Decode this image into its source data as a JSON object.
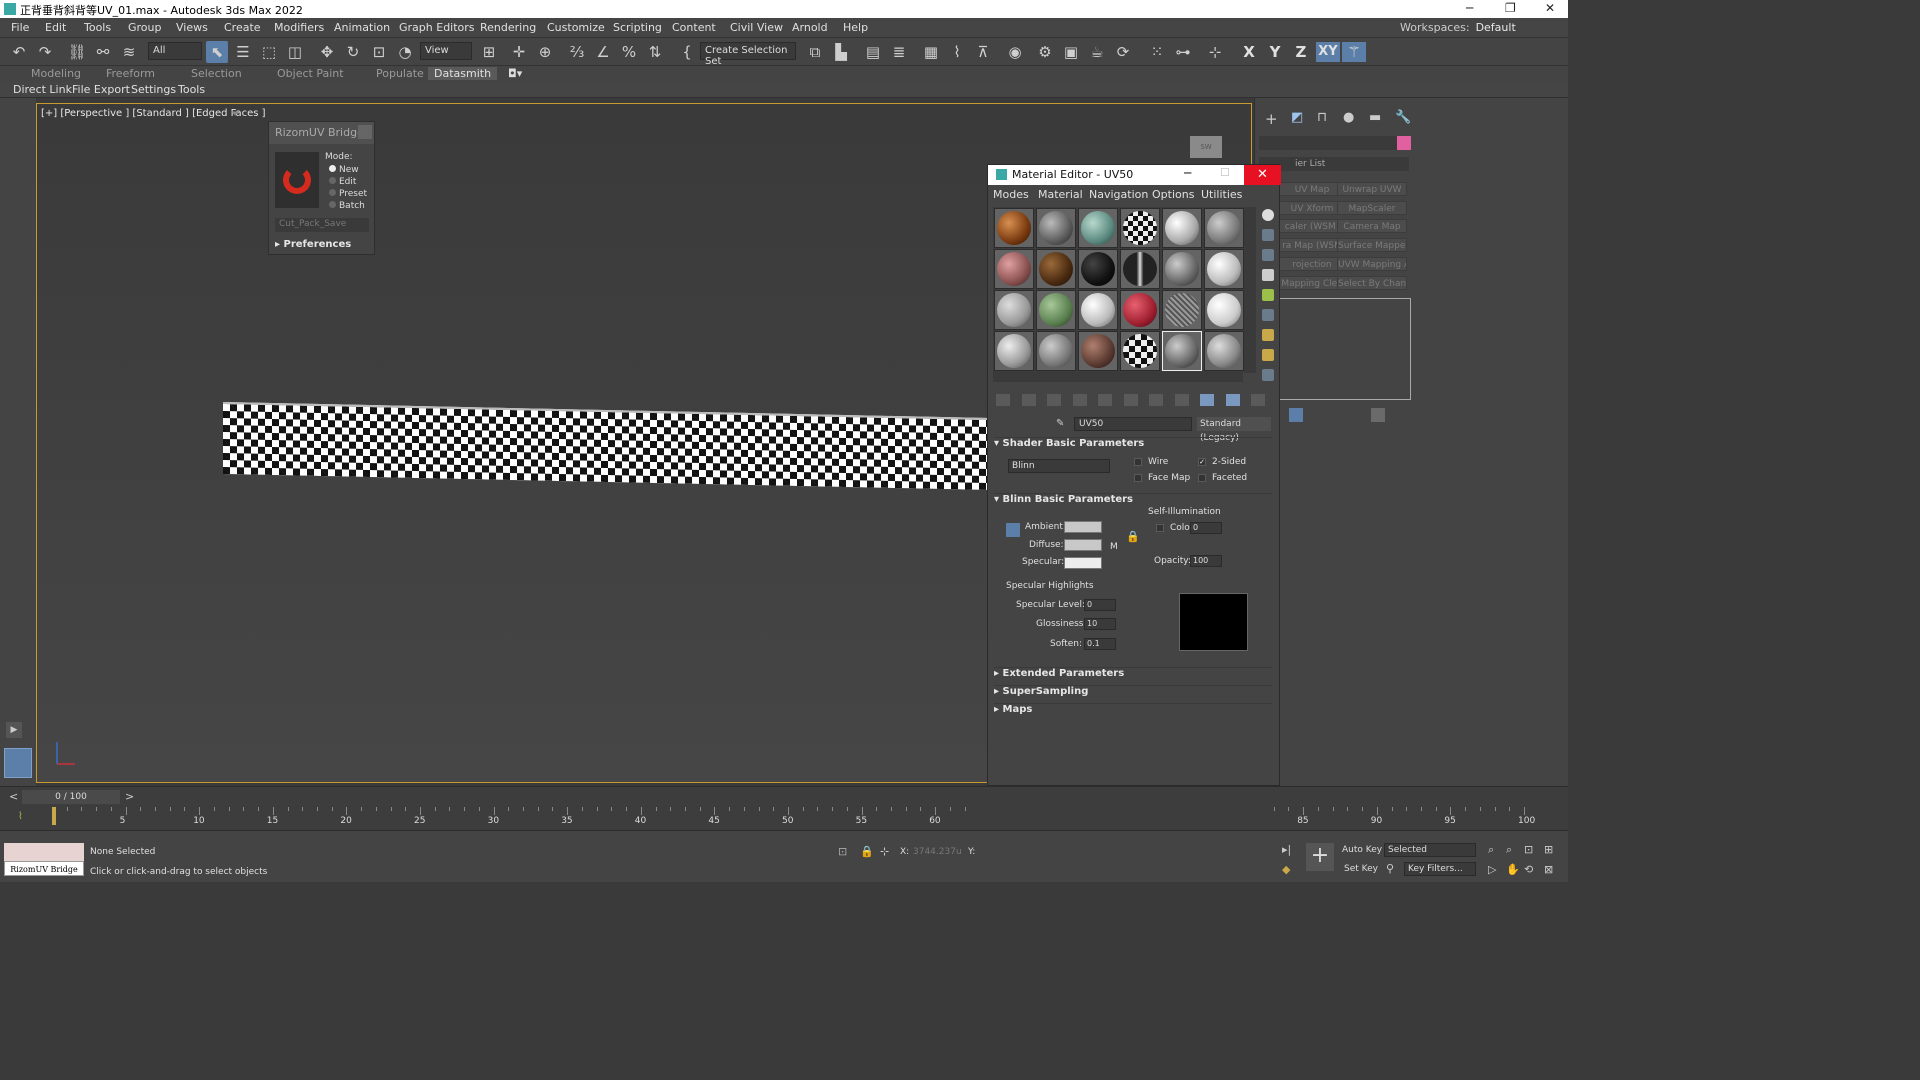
{
  "window": {
    "title": "正背垂背斜背等UV_01.max - Autodesk 3ds Max 2022",
    "minimize": "─",
    "restore": "❐",
    "close": "✕"
  },
  "menu": [
    "File",
    "Edit",
    "Tools",
    "Group",
    "Views",
    "Create",
    "Modifiers",
    "Animation",
    "Graph Editors",
    "Rendering",
    "Customize",
    "Scripting",
    "Content",
    "Civil View",
    "Arnold",
    "Help"
  ],
  "workspace": {
    "label": "Workspaces:",
    "value": "Default"
  },
  "toolbar": {
    "filter": "All",
    "refcoord": "View",
    "selection_set": "Create Selection Set",
    "axes": [
      "X",
      "Y",
      "Z",
      "XY"
    ]
  },
  "ribbon_tabs": [
    "Modeling",
    "Freeform",
    "Selection",
    "Object Paint",
    "Populate",
    "Datasmith"
  ],
  "secondary_menu": [
    "Direct Link",
    "File Export",
    "Settings",
    "Tools"
  ],
  "viewport": {
    "label": "[+] [Perspective ] [Standard ] [Edged Faces ]"
  },
  "rizom_bridge": {
    "title": "RizomUV Bridge",
    "mode_label": "Mode:",
    "modes": [
      "New",
      "Edit",
      "Preset",
      "Batch"
    ],
    "selected_mode": "New",
    "preset_dropdown": "Cut_Pack_Save",
    "preferences": "Preferences"
  },
  "material_editor": {
    "title": "Material Editor - UV50",
    "menu": [
      "Modes",
      "Material",
      "Navigation",
      "Options",
      "Utilities"
    ],
    "material_name": "UV50",
    "material_type": "Standard (Legacy)",
    "rollouts": {
      "shader_basic": "Shader Basic Parameters",
      "blinn_basic": "Blinn Basic Parameters",
      "extended": "Extended Parameters",
      "supersampling": "SuperSampling",
      "maps": "Maps"
    },
    "shader": "Blinn",
    "options": {
      "wire": "Wire",
      "two_sided": "2-Sided",
      "face_map": "Face Map",
      "faceted": "Faceted"
    },
    "colors": {
      "ambient_label": "Ambient:",
      "diffuse_label": "Diffuse:",
      "specular_label": "Specular:",
      "ambient": "#c8c8c8",
      "diffuse": "#c8c8c8",
      "specular": "#ececec",
      "map_button": "M"
    },
    "self_illum": {
      "title": "Self-Illumination",
      "color_label": "Color",
      "value": "0"
    },
    "opacity": {
      "label": "Opacity:",
      "value": "100"
    },
    "specular_highlights": {
      "title": "Specular Highlights",
      "level_label": "Specular Level:",
      "level": "0",
      "gloss_label": "Glossiness:",
      "gloss": "10",
      "soften_label": "Soften:",
      "soften": "0.1"
    }
  },
  "command_panel": {
    "modifier_list": "ier List",
    "buttons": [
      "UV Map",
      "Unwrap UVW",
      "UV Xform",
      "MapScaler",
      "caler (WSM)",
      "Camera Map",
      "ra Map (WSM",
      "Surface Mapper (",
      "rojection",
      "UVW Mapping Add",
      "Mapping Clea",
      "Select By Channel"
    ]
  },
  "timeline": {
    "frame": "0 / 100",
    "ticks": [
      "5",
      "10",
      "15",
      "20",
      "25",
      "30",
      "35",
      "40",
      "45",
      "50",
      "55",
      "60",
      "85",
      "90",
      "95",
      "100"
    ]
  },
  "status": {
    "selection": "None Selected",
    "prompt": "Click or click-and-drag to select objects",
    "rizom_button": "RizomUV Bridge",
    "x_label": "X:",
    "x_value": "3744.237u",
    "y_label": "Y:",
    "auto_key": "Auto Key",
    "set_key": "Set Key",
    "selected": "Selected",
    "key_filters": "Key Filters..."
  }
}
